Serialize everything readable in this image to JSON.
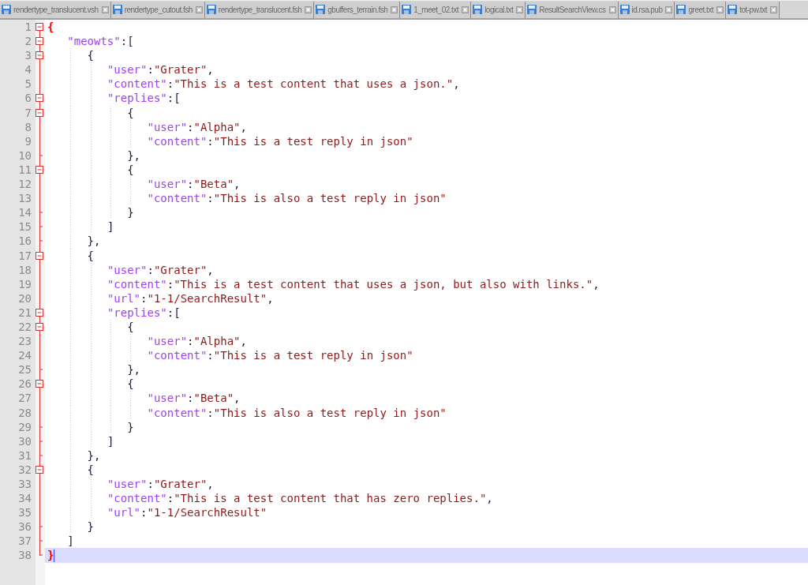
{
  "tabs": [
    {
      "label": "rendertype_translucent.vsh",
      "selected": false
    },
    {
      "label": "rendertype_cutout.fsh",
      "selected": false
    },
    {
      "label": "rendertype_translucent.fsh",
      "selected": false
    },
    {
      "label": "gbuffers_terrain.fsh",
      "selected": false
    },
    {
      "label": "1_meet_02.txt",
      "selected": false
    },
    {
      "label": "logical.txt",
      "selected": false
    },
    {
      "label": "ResultSearchView.cs",
      "selected": false
    },
    {
      "label": "id.rsa.pub",
      "selected": false
    },
    {
      "label": "greet.txt",
      "selected": false
    },
    {
      "label": "tot-pw.txt",
      "selected": false
    }
  ],
  "lines": [
    {
      "number": "1",
      "collapsible": true,
      "block_end": false,
      "current": false,
      "tokens": [
        {
          "kind": "brace",
          "text": "{"
        }
      ]
    },
    {
      "number": "2",
      "collapsible": true,
      "block_end": false,
      "current": false,
      "tokens": [
        {
          "kind": "key",
          "text": "\"meowts\""
        },
        {
          "kind": "punct",
          "text": ":["
        }
      ]
    },
    {
      "number": "3",
      "collapsible": true,
      "block_end": false,
      "current": false,
      "tokens": [
        {
          "kind": "punct",
          "text": "{"
        }
      ]
    },
    {
      "number": "4",
      "collapsible": false,
      "block_end": false,
      "current": false,
      "tokens": [
        {
          "kind": "key",
          "text": "\"user\""
        },
        {
          "kind": "punct",
          "text": ":"
        },
        {
          "kind": "string",
          "text": "\"Grater\""
        },
        {
          "kind": "punct",
          "text": ","
        }
      ]
    },
    {
      "number": "5",
      "collapsible": false,
      "block_end": false,
      "current": false,
      "tokens": [
        {
          "kind": "key",
          "text": "\"content\""
        },
        {
          "kind": "punct",
          "text": ":"
        },
        {
          "kind": "string",
          "text": "\"This is a test content that uses a json.\""
        },
        {
          "kind": "punct",
          "text": ","
        }
      ]
    },
    {
      "number": "6",
      "collapsible": true,
      "block_end": false,
      "current": false,
      "tokens": [
        {
          "kind": "key",
          "text": "\"replies\""
        },
        {
          "kind": "punct",
          "text": ":["
        }
      ]
    },
    {
      "number": "7",
      "collapsible": true,
      "block_end": false,
      "current": false,
      "tokens": [
        {
          "kind": "punct",
          "text": "{"
        }
      ]
    },
    {
      "number": "8",
      "collapsible": false,
      "block_end": false,
      "current": false,
      "tokens": [
        {
          "kind": "key",
          "text": "\"user\""
        },
        {
          "kind": "punct",
          "text": ":"
        },
        {
          "kind": "string",
          "text": "\"Alpha\""
        },
        {
          "kind": "punct",
          "text": ","
        }
      ]
    },
    {
      "number": "9",
      "collapsible": false,
      "block_end": false,
      "current": false,
      "tokens": [
        {
          "kind": "key",
          "text": "\"content\""
        },
        {
          "kind": "punct",
          "text": ":"
        },
        {
          "kind": "string",
          "text": "\"This is a test reply in json\""
        }
      ]
    },
    {
      "number": "10",
      "collapsible": false,
      "block_end": true,
      "current": false,
      "tokens": [
        {
          "kind": "punct",
          "text": "},"
        }
      ]
    },
    {
      "number": "11",
      "collapsible": true,
      "block_end": false,
      "current": false,
      "tokens": [
        {
          "kind": "punct",
          "text": "{"
        }
      ]
    },
    {
      "number": "12",
      "collapsible": false,
      "block_end": false,
      "current": false,
      "tokens": [
        {
          "kind": "key",
          "text": "\"user\""
        },
        {
          "kind": "punct",
          "text": ":"
        },
        {
          "kind": "string",
          "text": "\"Beta\""
        },
        {
          "kind": "punct",
          "text": ","
        }
      ]
    },
    {
      "number": "13",
      "collapsible": false,
      "block_end": false,
      "current": false,
      "tokens": [
        {
          "kind": "key",
          "text": "\"content\""
        },
        {
          "kind": "punct",
          "text": ":"
        },
        {
          "kind": "string",
          "text": "\"This is also a test reply in json\""
        }
      ]
    },
    {
      "number": "14",
      "collapsible": false,
      "block_end": true,
      "current": false,
      "tokens": [
        {
          "kind": "punct",
          "text": "}"
        }
      ]
    },
    {
      "number": "15",
      "collapsible": false,
      "block_end": true,
      "current": false,
      "tokens": [
        {
          "kind": "punct",
          "text": "]"
        }
      ]
    },
    {
      "number": "16",
      "collapsible": false,
      "block_end": true,
      "current": false,
      "tokens": [
        {
          "kind": "punct",
          "text": "},"
        }
      ]
    },
    {
      "number": "17",
      "collapsible": true,
      "block_end": false,
      "current": false,
      "tokens": [
        {
          "kind": "punct",
          "text": "{"
        }
      ]
    },
    {
      "number": "18",
      "collapsible": false,
      "block_end": false,
      "current": false,
      "tokens": [
        {
          "kind": "key",
          "text": "\"user\""
        },
        {
          "kind": "punct",
          "text": ":"
        },
        {
          "kind": "string",
          "text": "\"Grater\""
        },
        {
          "kind": "punct",
          "text": ","
        }
      ]
    },
    {
      "number": "19",
      "collapsible": false,
      "block_end": false,
      "current": false,
      "tokens": [
        {
          "kind": "key",
          "text": "\"content\""
        },
        {
          "kind": "punct",
          "text": ":"
        },
        {
          "kind": "string",
          "text": "\"This is a test content that uses a json, but also with links.\""
        },
        {
          "kind": "punct",
          "text": ","
        }
      ]
    },
    {
      "number": "20",
      "collapsible": false,
      "block_end": false,
      "current": false,
      "tokens": [
        {
          "kind": "key",
          "text": "\"url\""
        },
        {
          "kind": "punct",
          "text": ":"
        },
        {
          "kind": "string",
          "text": "\"1-1/SearchResult\""
        },
        {
          "kind": "punct",
          "text": ","
        }
      ]
    },
    {
      "number": "21",
      "collapsible": true,
      "block_end": false,
      "current": false,
      "tokens": [
        {
          "kind": "key",
          "text": "\"replies\""
        },
        {
          "kind": "punct",
          "text": ":["
        }
      ]
    },
    {
      "number": "22",
      "collapsible": true,
      "block_end": false,
      "current": false,
      "tokens": [
        {
          "kind": "punct",
          "text": "{"
        }
      ]
    },
    {
      "number": "23",
      "collapsible": false,
      "block_end": false,
      "current": false,
      "tokens": [
        {
          "kind": "key",
          "text": "\"user\""
        },
        {
          "kind": "punct",
          "text": ":"
        },
        {
          "kind": "string",
          "text": "\"Alpha\""
        },
        {
          "kind": "punct",
          "text": ","
        }
      ]
    },
    {
      "number": "24",
      "collapsible": false,
      "block_end": false,
      "current": false,
      "tokens": [
        {
          "kind": "key",
          "text": "\"content\""
        },
        {
          "kind": "punct",
          "text": ":"
        },
        {
          "kind": "string",
          "text": "\"This is a test reply in json\""
        }
      ]
    },
    {
      "number": "25",
      "collapsible": false,
      "block_end": true,
      "current": false,
      "tokens": [
        {
          "kind": "punct",
          "text": "},"
        }
      ]
    },
    {
      "number": "26",
      "collapsible": true,
      "block_end": false,
      "current": false,
      "tokens": [
        {
          "kind": "punct",
          "text": "{"
        }
      ]
    },
    {
      "number": "27",
      "collapsible": false,
      "block_end": false,
      "current": false,
      "tokens": [
        {
          "kind": "key",
          "text": "\"user\""
        },
        {
          "kind": "punct",
          "text": ":"
        },
        {
          "kind": "string",
          "text": "\"Beta\""
        },
        {
          "kind": "punct",
          "text": ","
        }
      ]
    },
    {
      "number": "28",
      "collapsible": false,
      "block_end": false,
      "current": false,
      "tokens": [
        {
          "kind": "key",
          "text": "\"content\""
        },
        {
          "kind": "punct",
          "text": ":"
        },
        {
          "kind": "string",
          "text": "\"This is also a test reply in json\""
        }
      ]
    },
    {
      "number": "29",
      "collapsible": false,
      "block_end": true,
      "current": false,
      "tokens": [
        {
          "kind": "punct",
          "text": "}"
        }
      ]
    },
    {
      "number": "30",
      "collapsible": false,
      "block_end": true,
      "current": false,
      "tokens": [
        {
          "kind": "punct",
          "text": "]"
        }
      ]
    },
    {
      "number": "31",
      "collapsible": false,
      "block_end": true,
      "current": false,
      "tokens": [
        {
          "kind": "punct",
          "text": "},"
        }
      ]
    },
    {
      "number": "32",
      "collapsible": true,
      "block_end": false,
      "current": false,
      "tokens": [
        {
          "kind": "punct",
          "text": "{"
        }
      ]
    },
    {
      "number": "33",
      "collapsible": false,
      "block_end": false,
      "current": false,
      "tokens": [
        {
          "kind": "key",
          "text": "\"user\""
        },
        {
          "kind": "punct",
          "text": ":"
        },
        {
          "kind": "string",
          "text": "\"Grater\""
        },
        {
          "kind": "punct",
          "text": ","
        }
      ]
    },
    {
      "number": "34",
      "collapsible": false,
      "block_end": false,
      "current": false,
      "tokens": [
        {
          "kind": "key",
          "text": "\"content\""
        },
        {
          "kind": "punct",
          "text": ":"
        },
        {
          "kind": "string",
          "text": "\"This is a test content that has zero replies.\""
        },
        {
          "kind": "punct",
          "text": ","
        }
      ]
    },
    {
      "number": "35",
      "collapsible": false,
      "block_end": false,
      "current": false,
      "tokens": [
        {
          "kind": "key",
          "text": "\"url\""
        },
        {
          "kind": "punct",
          "text": ":"
        },
        {
          "kind": "string",
          "text": "\"1-1/SearchResult\""
        }
      ]
    },
    {
      "number": "36",
      "collapsible": false,
      "block_end": true,
      "current": false,
      "tokens": [
        {
          "kind": "punct",
          "text": "}"
        }
      ]
    },
    {
      "number": "37",
      "collapsible": false,
      "block_end": true,
      "current": false,
      "tokens": [
        {
          "kind": "punct",
          "text": "]"
        }
      ]
    },
    {
      "number": "38",
      "collapsible": false,
      "block_end": true,
      "current": true,
      "tokens": [
        {
          "kind": "brace",
          "text": "}"
        }
      ]
    }
  ]
}
